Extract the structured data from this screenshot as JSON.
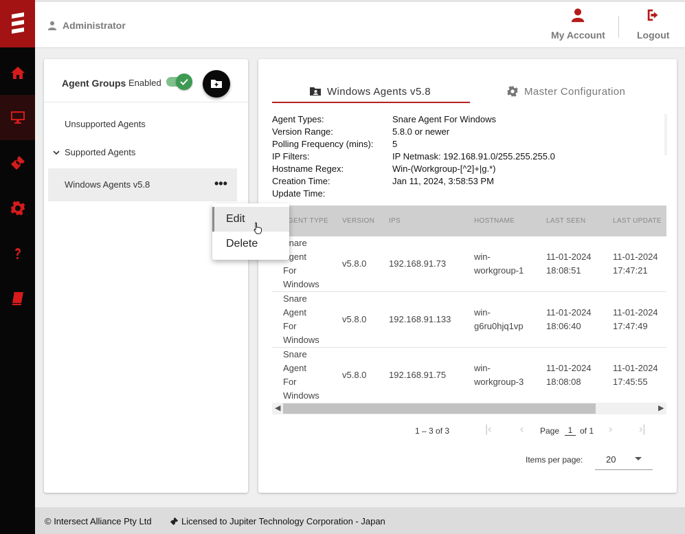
{
  "header": {
    "user_name": "Administrator",
    "my_account_label": "My Account",
    "logout_label": "Logout"
  },
  "sidenav": {
    "items": [
      "home-icon",
      "monitor-icon",
      "ticket-icon",
      "gear-icon",
      "question-icon",
      "book-icon"
    ],
    "active": "monitor-icon"
  },
  "agent_groups": {
    "title": "Agent Groups",
    "enabled_label": "Enabled",
    "enabled": true,
    "unsupported_label": "Unsupported Agents",
    "supported_label": "Supported Agents",
    "selected_group": "Windows Agents v5.8"
  },
  "context_menu": {
    "edit_label": "Edit",
    "delete_label": "Delete"
  },
  "tabs": {
    "group_tab_label": "Windows Agents v5.8",
    "config_tab_label": "Master Configuration"
  },
  "details": {
    "agent_types_key": "Agent Types:",
    "agent_types_val": "Snare Agent For Windows",
    "version_range_key": "Version Range:",
    "version_range_val": "5.8.0 or newer",
    "polling_key": "Polling Frequency (mins):",
    "polling_val": "5",
    "ip_filters_key": "IP Filters:",
    "ip_filters_val": "IP Netmask: 192.168.91.0/255.255.255.0",
    "hostname_key": "Hostname Regex:",
    "hostname_val": "Win-(Workgroup-[^2]+|g.*)",
    "creation_key": "Creation Time:",
    "creation_val": "Jan 11, 2024, 3:58:53 PM",
    "update_key": "Update Time:",
    "update_val": ""
  },
  "table": {
    "columns": [
      "AGENT TYPE",
      "VERSION",
      "IPS",
      "HOSTNAME",
      "LAST SEEN",
      "LAST UPDATE"
    ],
    "rows": [
      {
        "agent_type": [
          "Snare",
          "Agent",
          "For",
          "Windows"
        ],
        "version": "v5.8.0",
        "ips": "192.168.91.73",
        "hostname": [
          "win-",
          "workgroup-1"
        ],
        "last_seen": [
          "11-01-2024",
          "18:08:51"
        ],
        "last_update": [
          "11-01-2024",
          "17:47:21"
        ]
      },
      {
        "agent_type": [
          "Snare",
          "Agent",
          "For",
          "Windows"
        ],
        "version": "v5.8.0",
        "ips": "192.168.91.133",
        "hostname": [
          "win-",
          "g6ru0hjq1vp"
        ],
        "last_seen": [
          "11-01-2024",
          "18:06:40"
        ],
        "last_update": [
          "11-01-2024",
          "17:47:49"
        ]
      },
      {
        "agent_type": [
          "Snare",
          "Agent",
          "For",
          "Windows"
        ],
        "version": "v5.8.0",
        "ips": "192.168.91.75",
        "hostname": [
          "win-",
          "workgroup-3"
        ],
        "last_seen": [
          "11-01-2024",
          "18:08:08"
        ],
        "last_update": [
          "11-01-2024",
          "17:45:55"
        ]
      }
    ]
  },
  "paginator": {
    "range_label": "1 – 3 of 3",
    "page_label": "Page",
    "page_value": "1",
    "of_label": "of 1",
    "items_per_page_label": "Items per page:",
    "items_per_page_value": "20"
  },
  "footer": {
    "copyright": "© Intersect Alliance Pty Ltd",
    "license": "Licensed to Jupiter Technology Corporation - Japan"
  },
  "colors": {
    "brand_red": "#b32020",
    "toggle_green": "#3d9a52"
  }
}
